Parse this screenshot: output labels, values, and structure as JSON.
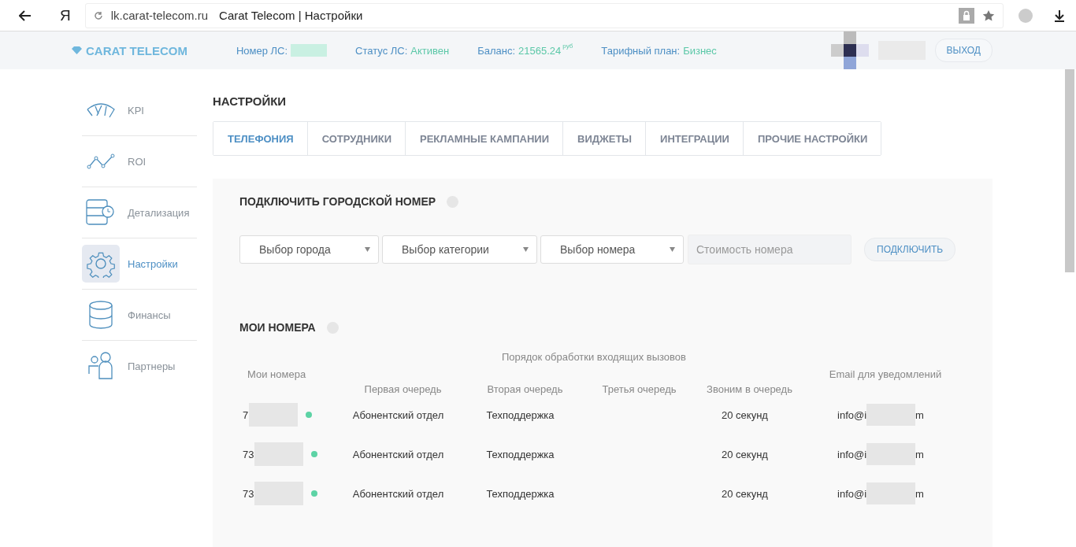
{
  "browser": {
    "url": "lk.carat-telecom.ru",
    "title": "Carat Telecom | Настройки",
    "logo_letter": "Я"
  },
  "header": {
    "brand": "CARAT TELECOM",
    "account_label": "Номер ЛС:",
    "status_label": "Статус ЛС:",
    "status_value": "Активен",
    "balance_label": "Баланс:",
    "balance_value": "21565.24",
    "balance_unit": "руб",
    "plan_label": "Тарифный план:",
    "plan_value": "Бизнес",
    "logout": "ВЫХОД"
  },
  "sidebar": {
    "items": [
      {
        "label": "KPI",
        "kind": "gauge",
        "selected": false
      },
      {
        "label": "ROI",
        "kind": "chart",
        "selected": false
      },
      {
        "label": "Детализация",
        "kind": "table",
        "selected": false
      },
      {
        "label": "Настройки",
        "kind": "gear",
        "selected": true
      },
      {
        "label": "Финансы",
        "kind": "database",
        "selected": false
      },
      {
        "label": "Партнеры",
        "kind": "people",
        "selected": false
      }
    ]
  },
  "page_title": "НАСТРОЙКИ",
  "tabs": [
    {
      "label": "ТЕЛЕФОНИЯ",
      "selected": true
    },
    {
      "label": "СОТРУДНИКИ",
      "selected": false
    },
    {
      "label": "РЕКЛАМНЫЕ КАМПАНИИ",
      "selected": false
    },
    {
      "label": "ВИДЖЕТЫ",
      "selected": false
    },
    {
      "label": "ИНТЕГРАЦИИ",
      "selected": false
    },
    {
      "label": "ПРОЧИЕ НАСТРОЙКИ",
      "selected": false
    }
  ],
  "connect": {
    "title": "ПОДКЛЮЧИТЬ ГОРОДСКОЙ НОМЕР",
    "selects": [
      "Выбор города",
      "Выбор категории",
      "Выбор номера"
    ],
    "price_placeholder": "Стоимость номера",
    "button": "ПОДКЛЮЧИТЬ"
  },
  "numbers": {
    "title": "МОИ НОМЕРА",
    "group_header": "Порядок обработки входящих вызовов",
    "columns": [
      "Мои номера",
      "Первая очередь",
      "Вторая очередь",
      "Третья очередь",
      "Звоним в очередь",
      "Email для уведомлений"
    ],
    "rows": [
      {
        "number_start": "7",
        "color": "#5dd3a5",
        "first": "Абонентский отдел",
        "second": "Техподдержка",
        "wait": "20 секунд",
        "email_start": "info@i",
        "email_end": "m"
      },
      {
        "number_start": "73",
        "color": "#5dd3a5",
        "first": "Абонентский отдел",
        "second": "Техподдержка",
        "wait": "20 секунд",
        "email_start": "info@i",
        "email_end": "m"
      },
      {
        "number_start": "73",
        "color": "#5dd3a5",
        "first": "Абонентский отдел",
        "second": "Техподдержка",
        "wait": "20 секунд",
        "email_start": "info@i",
        "email_end": "m"
      }
    ]
  }
}
